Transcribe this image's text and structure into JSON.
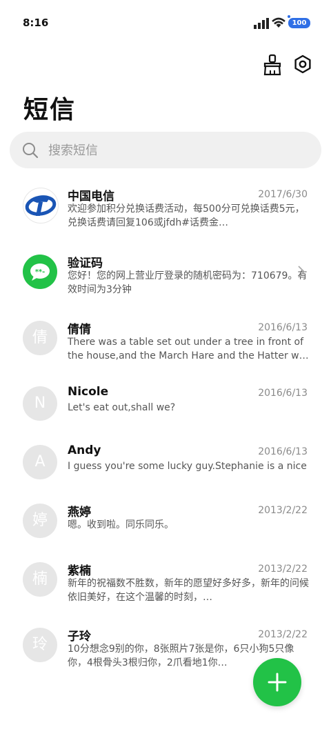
{
  "status_bar": {
    "time": "8:16",
    "battery": "100"
  },
  "header": {
    "title": "短信"
  },
  "search": {
    "placeholder": "搜索短信"
  },
  "messages": [
    {
      "name": "中国电信",
      "date": "2017/6/30",
      "preview": "欢迎参加积分兑换话费活动，每500分可兑换话费5元，兑换话费请回复106或jfdh#话费金…",
      "avatar_letter": ""
    },
    {
      "name": "验证码",
      "date": "",
      "preview": "您好！您的网上营业厅登录的随机密码为：710679。有效时间为3分钟",
      "avatar_letter": "**-"
    },
    {
      "name": "倩倩",
      "date": "2016/6/13",
      "preview": "There was a table set out under a tree in front of the house,and the March Hare and the Hatter were hav …",
      "avatar_letter": "倩"
    },
    {
      "name": "Nicole",
      "date": "2016/6/13",
      "preview": "Let's eat out,shall we?",
      "avatar_letter": "N"
    },
    {
      "name": "Andy",
      "date": "2016/6/13",
      "preview": "I guess you're some lucky guy.Stephanie is a nice girl.",
      "avatar_letter": "A"
    },
    {
      "name": "燕婷",
      "date": "2013/2/22",
      "preview": "嗯。收到啦。同乐同乐。",
      "avatar_letter": "婷"
    },
    {
      "name": "紫楠",
      "date": "2013/2/22",
      "preview": "新年的祝福数不胜数，新年的愿望好多好多，新年的问候依旧美好，在这个温馨的时刻，…",
      "avatar_letter": "楠"
    },
    {
      "name": "子玲",
      "date": "2013/2/22",
      "preview": "10分想念9别的你，8张照片7张是你，6只小狗5只像你，4根骨头3根归你，2爪看地1你…",
      "avatar_letter": "玲"
    }
  ],
  "colors": {
    "accent": "#22c247",
    "battery": "#2f6fe6",
    "telecom_blue": "#1a55b5"
  },
  "icons": {
    "clean": "broom-icon",
    "settings": "gear-icon",
    "search": "search-icon",
    "fab": "plus-icon"
  }
}
